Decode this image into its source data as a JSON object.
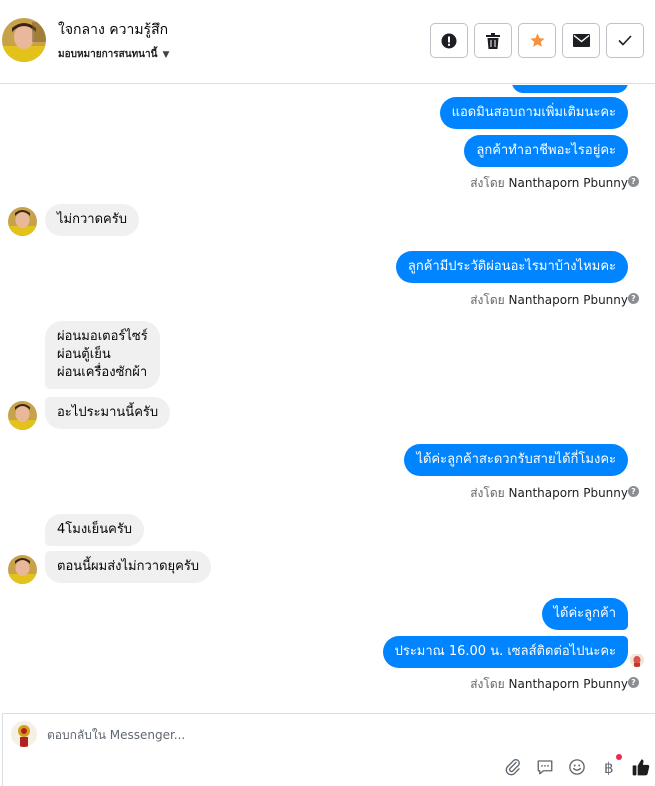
{
  "header": {
    "contact_name": "ใจกลาง ความรู้สึก",
    "assign_label": "มอบหมายการสนทนานี้"
  },
  "messages": {
    "m0": "",
    "m1": "แอดมินสอบถามเพิ่มเติมนะคะ",
    "m2": "ลูกค้าทำอาชีพอะไรอยู่คะ",
    "m3": "ไม่กวาดครับ",
    "m4": "ลูกค้ามีประวัติผ่อนอะไรมาบ้างไหมคะ",
    "m5_line1": "ผ่อนมอเตอร์ไซร์",
    "m5_line2": "ผ่อนตู้เย็น",
    "m5_line3": "ผ่อนเครื่องซักผ้า",
    "m6": "อะไประมานนี้ครับ",
    "m7": "ได้ค่ะลูกค้าสะดวกรับสายได้กี่โมงคะ",
    "m8": "4โมงเย็นครับ",
    "m9": "ตอนนี้ผมส่งไม่กวาดยุครับ",
    "m10": "ได้ค่ะลูกค้า",
    "m11": "ประมาณ 16.00 น. เซลส์ติดต่อไปนะคะ"
  },
  "sender": {
    "prefix": "ส่งโดย",
    "name": "Nanthaporn Pbunny"
  },
  "composer": {
    "placeholder": "ตอบกลับใน Messenger..."
  },
  "colors": {
    "outgoing": "#0084ff",
    "incoming": "#f0f0f0",
    "star": "#f7923a"
  }
}
